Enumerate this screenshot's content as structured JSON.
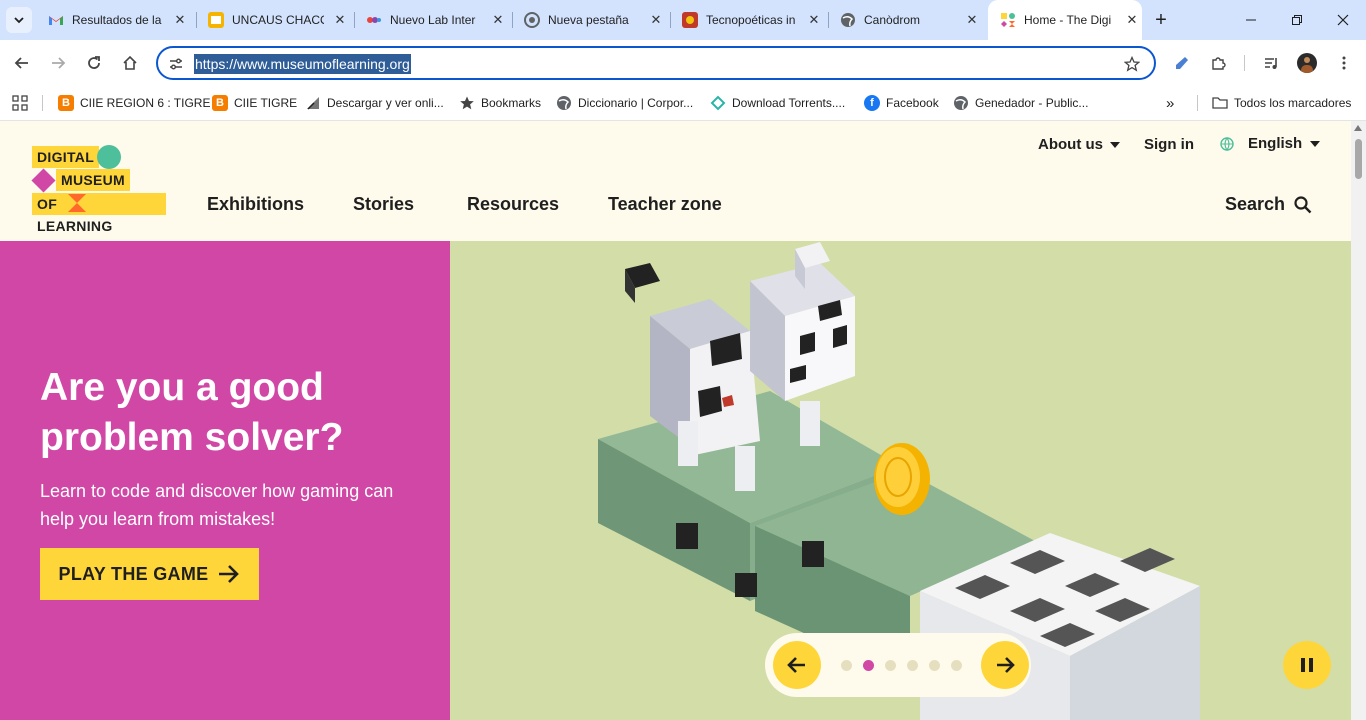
{
  "browser": {
    "tabs": [
      {
        "title": "Resultados de la",
        "icon": "gmail-icon"
      },
      {
        "title": "UNCAUS CHACO",
        "icon": "slides-icon"
      },
      {
        "title": "Nuevo Lab Inter",
        "icon": "lab-icon"
      },
      {
        "title": "Nueva pestaña",
        "icon": "chrome-icon"
      },
      {
        "title": "Tecnopoéticas in",
        "icon": "bird-icon"
      },
      {
        "title": "Canòdrom",
        "icon": "globe-icon"
      },
      {
        "title": "Home - The Digi",
        "icon": "dml-icon",
        "active": true
      }
    ],
    "url": "https://www.museumoflearning.org",
    "bookmarks": [
      {
        "label": "CIIE REGION 6 : TIGRE",
        "icon": "blogger-icon"
      },
      {
        "label": "CIIE TIGRE",
        "icon": "blogger-icon"
      },
      {
        "label": "Descargar y ver onli...",
        "icon": "download-site-icon"
      },
      {
        "label": "Bookmarks",
        "icon": "star-icon"
      },
      {
        "label": "Diccionario | Corpor...",
        "icon": "globe-icon"
      },
      {
        "label": "Download Torrents....",
        "icon": "torrent-icon"
      },
      {
        "label": "Facebook",
        "icon": "facebook-icon"
      },
      {
        "label": "Genedador - Public...",
        "icon": "globe-icon"
      }
    ],
    "all_bookmarks_label": "Todos los marcadores"
  },
  "site": {
    "logo": {
      "line1": "DIGITAL",
      "line2": "MUSEUM",
      "line3a": "OF",
      "line3b": "LEARNING"
    },
    "utility_nav": {
      "about": "About us",
      "signin": "Sign in",
      "language": "English"
    },
    "main_nav": [
      "Exhibitions",
      "Stories",
      "Resources",
      "Teacher zone"
    ],
    "search_label": "Search",
    "hero": {
      "title": "Are you a good problem solver?",
      "subtitle": "Learn to code and discover how gaming can help you learn from mistakes!",
      "cta": "PLAY THE GAME"
    },
    "carousel": {
      "slide_count": 6,
      "active_slide": 2
    }
  },
  "colors": {
    "brand_yellow": "#ffd63a",
    "brand_magenta": "#d147a6",
    "brand_teal": "#4dbf9b",
    "brand_orange": "#ff6a2b",
    "header_bg": "#fefbec",
    "hero_image_bg": "#d2dda8"
  }
}
